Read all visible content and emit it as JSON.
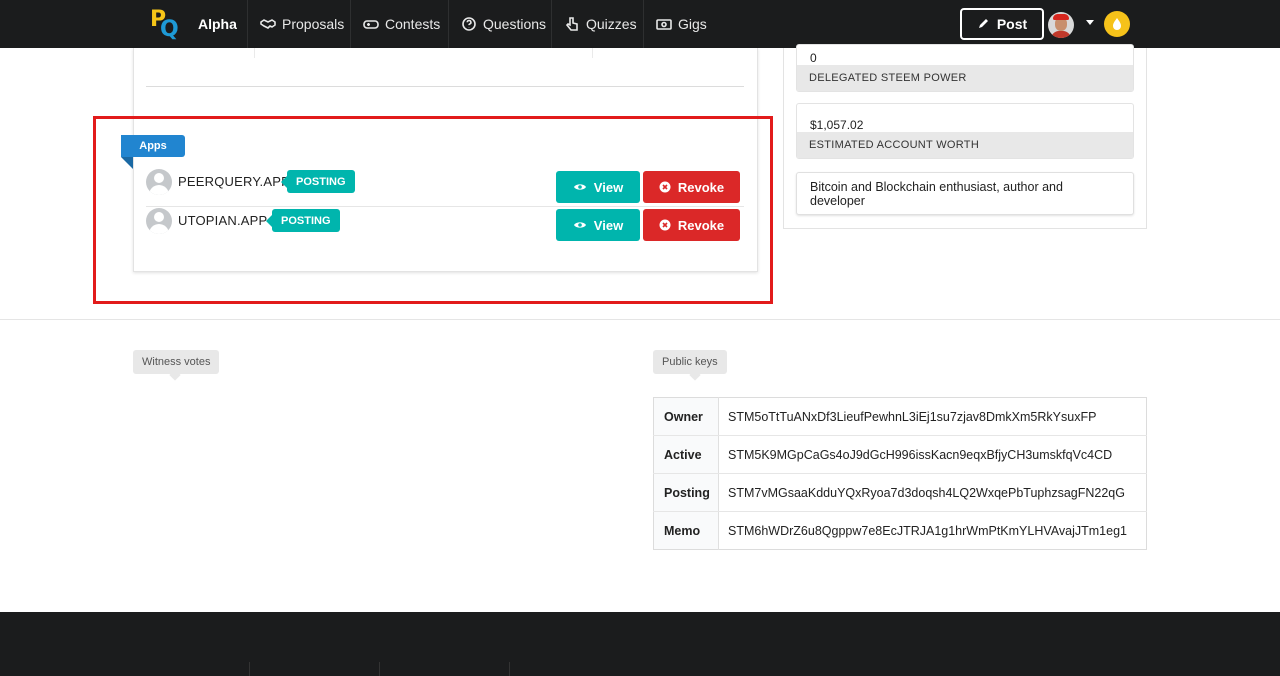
{
  "nav": {
    "brand": "Alpha",
    "items": [
      {
        "label": "Proposals",
        "icon": "handshake-icon"
      },
      {
        "label": "Contests",
        "icon": "gamepad-icon"
      },
      {
        "label": "Questions",
        "icon": "question-circle-icon"
      },
      {
        "label": "Quizzes",
        "icon": "pointer-icon"
      },
      {
        "label": "Gigs",
        "icon": "money-icon"
      }
    ],
    "post_label": "Post"
  },
  "apps": {
    "ribbon_label": "Apps",
    "rows": [
      {
        "name": "PEERQUERY.APP",
        "tag": "POSTING",
        "view_label": "View",
        "revoke_label": "Revoke"
      },
      {
        "name": "UTOPIAN.APP",
        "tag": "POSTING",
        "view_label": "View",
        "revoke_label": "Revoke"
      }
    ]
  },
  "stats": [
    {
      "value": "0",
      "label": "DELEGATED STEEM POWER"
    },
    {
      "value": "$1,057.02",
      "label": "ESTIMATED ACCOUNT WORTH"
    }
  ],
  "bio": "Bitcoin and Blockchain enthusiast, author and developer",
  "witness_votes_label": "Witness votes",
  "public_keys": {
    "label": "Public keys",
    "rows": [
      {
        "key": "Owner",
        "value": "STM5oTtTuANxDf3LieufPewhnL3iEj1su7zjav8DmkXm5RkYsuxFP"
      },
      {
        "key": "Active",
        "value": "STM5K9MGpCaGs4oJ9dGcH996issKacn9eqxBfjyCH3umskfqVc4CD"
      },
      {
        "key": "Posting",
        "value": "STM7vMGsaaKdduYQxRyoa7d3doqsh4LQ2WxqePbTuphzsagFN22qG"
      },
      {
        "key": "Memo",
        "value": "STM6hWDrZ6u8Qgppw7e8EcJTRJA1g1hrWmPtKmYLHVAvajJTm1eg1"
      }
    ]
  },
  "colors": {
    "teal": "#00b5ad",
    "red": "#db2828",
    "blue": "#2185d0",
    "highlight": "#e21b1b"
  }
}
